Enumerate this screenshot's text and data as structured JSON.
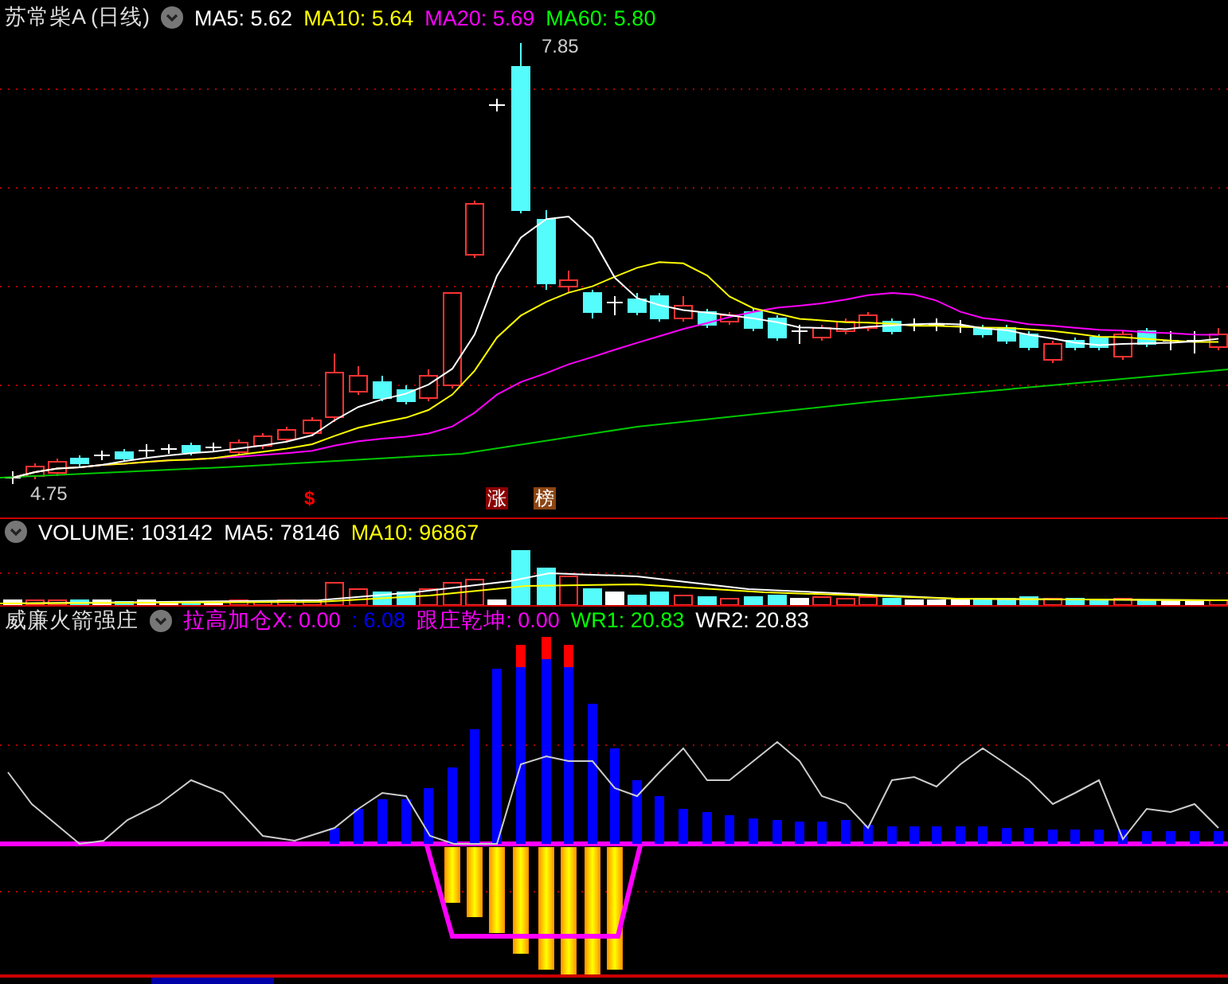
{
  "main_panel": {
    "title": "苏常柴A (日线)",
    "indicators": [
      {
        "label": "MA5: 5.62",
        "color": "#ffffff"
      },
      {
        "label": "MA10: 5.64",
        "color": "#ffff00"
      },
      {
        "label": "MA20: 5.69",
        "color": "#ff00ff"
      },
      {
        "label": "MA60: 5.80",
        "color": "#00ff00"
      }
    ],
    "high_label": "7.85",
    "low_label": "4.75",
    "markers": [
      {
        "kind": "symbol",
        "text": "$",
        "color": "#ff0000"
      },
      {
        "kind": "tag",
        "text": "涨",
        "color": "#8b0000"
      },
      {
        "kind": "tag",
        "text": "榜",
        "color": "#8b4513"
      }
    ]
  },
  "volume_panel": {
    "indicators": [
      {
        "label": "VOLUME: 103142",
        "color": "#ffffff"
      },
      {
        "label": "MA5: 78146",
        "color": "#ffffff"
      },
      {
        "label": "MA10: 96867",
        "color": "#ffff00"
      }
    ]
  },
  "indicator_panel": {
    "title": "威廉火箭强庄",
    "indicators": [
      {
        "label": "拉高加仓X: 0.00",
        "color": "#ff00ff"
      },
      {
        "label": ": 6.08",
        "color": "#0000ff"
      },
      {
        "label": "跟庄乾坤: 0.00",
        "color": "#ff00ff"
      },
      {
        "label": "WR1: 20.83",
        "color": "#00ff00"
      },
      {
        "label": "WR2: 20.83",
        "color": "#ffffff"
      }
    ]
  }
}
